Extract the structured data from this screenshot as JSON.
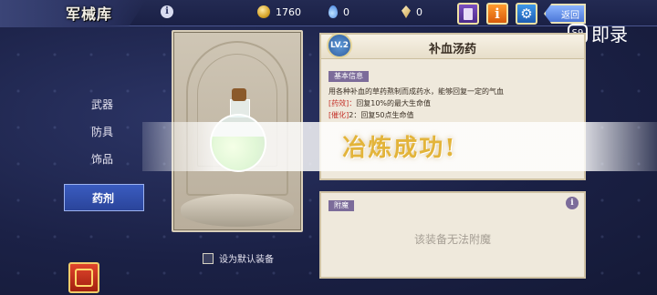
{
  "header": {
    "title": "军械库",
    "info_symbol": "i",
    "gold": "1760",
    "water": "0",
    "crystal": "0",
    "info_button_symbol": "i",
    "settings_symbol": "⚙",
    "back_label": "返回",
    "close_symbol": "✕"
  },
  "watermark": {
    "logo": "S9",
    "text": "即录"
  },
  "sidebar": {
    "items": [
      {
        "label": "武器"
      },
      {
        "label": "防具"
      },
      {
        "label": "饰品"
      },
      {
        "label": "药剂"
      }
    ],
    "active": "药剂"
  },
  "item": {
    "name": "补血汤药",
    "level_badge": "LV.2",
    "section_label": "基本信息",
    "description": "用各种补血的草药熬制而成药水，能够回复一定的气血",
    "effect_tag": "[药效]：",
    "effect_text": "回复10%的最大生命值",
    "refine_tag": "[催化]",
    "refine_text": "2：回复50点生命值"
  },
  "checkbox": {
    "label": "设为默认装备",
    "checked": false
  },
  "enchant": {
    "header": "附魔",
    "info_symbol": "i",
    "message": "该装备无法附魔"
  },
  "toast": {
    "text": "冶炼成功!"
  },
  "colors": {
    "accent": "#3a5cc0",
    "toast_text": "#e3b43a",
    "panel": "#efe9dc"
  }
}
